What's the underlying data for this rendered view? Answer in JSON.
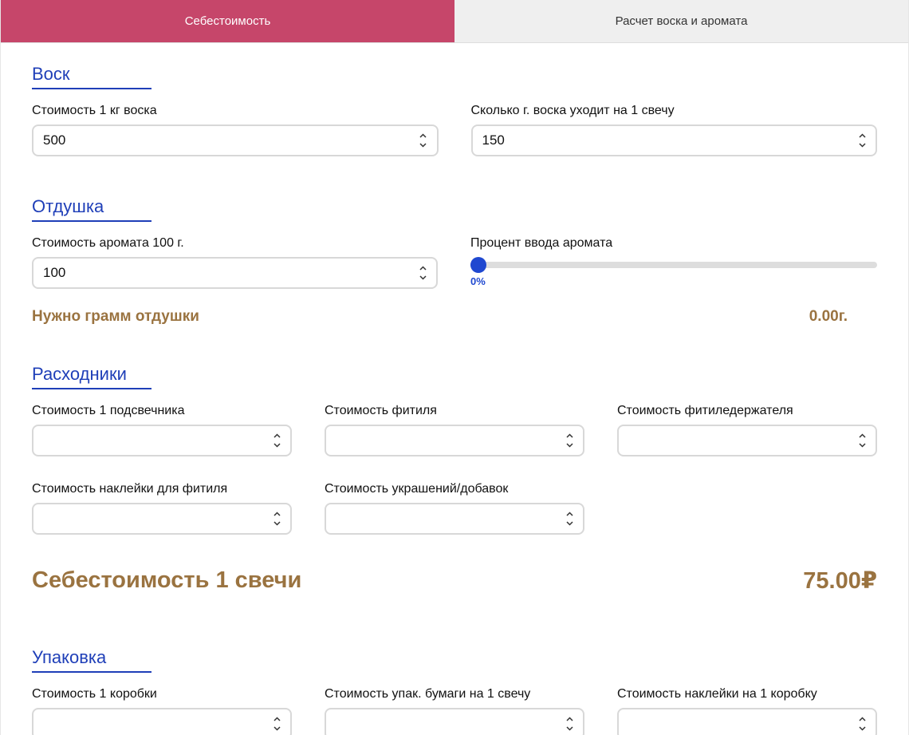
{
  "tabs": [
    {
      "label": "Себестоимость",
      "active": true
    },
    {
      "label": "Расчет воска и аромата",
      "active": false
    }
  ],
  "colors": {
    "tab_active": "#c6466a",
    "section_title": "#1f3fb8",
    "accent_blue": "#1f48d0",
    "result_brown": "#9a7340"
  },
  "wax": {
    "title": "Воск",
    "cost_per_kg": {
      "label": "Стоимость 1 кг воска",
      "value": "500"
    },
    "grams_per_candle": {
      "label": "Сколько г. воска уходит на 1 свечу",
      "value": "150"
    }
  },
  "fragrance": {
    "title": "Отдушка",
    "cost_100g": {
      "label": "Стоимость аромата 100 г.",
      "value": "100"
    },
    "percent": {
      "label": "Процент ввода аромата",
      "value_text": "0%",
      "value": 0
    },
    "grams_needed": {
      "label": "Нужно грамм отдушки",
      "value": "0.00г."
    }
  },
  "consumables": {
    "title": "Расходники",
    "fields": [
      {
        "label": "Стоимость 1 подсвечника",
        "value": ""
      },
      {
        "label": "Стоимость фитиля",
        "value": ""
      },
      {
        "label": "Стоимость фитиледержателя",
        "value": ""
      },
      {
        "label": "Стоимость наклейки для фитиля",
        "value": ""
      },
      {
        "label": "Стоимость украшений/добавок",
        "value": ""
      }
    ]
  },
  "cost_per_candle": {
    "label": "Себестоимость 1 свечи",
    "value": "75.00₽"
  },
  "packaging": {
    "title": "Упаковка",
    "fields": [
      {
        "label": "Стоимость 1 коробки",
        "value": ""
      },
      {
        "label": "Стоимость упак. бумаги на 1 свечу",
        "value": ""
      },
      {
        "label": "Стоимость наклейки на 1 коробку",
        "value": ""
      }
    ]
  },
  "icons": {
    "spinner": "chevron-up-down-icon",
    "slider_thumb": "circle"
  }
}
